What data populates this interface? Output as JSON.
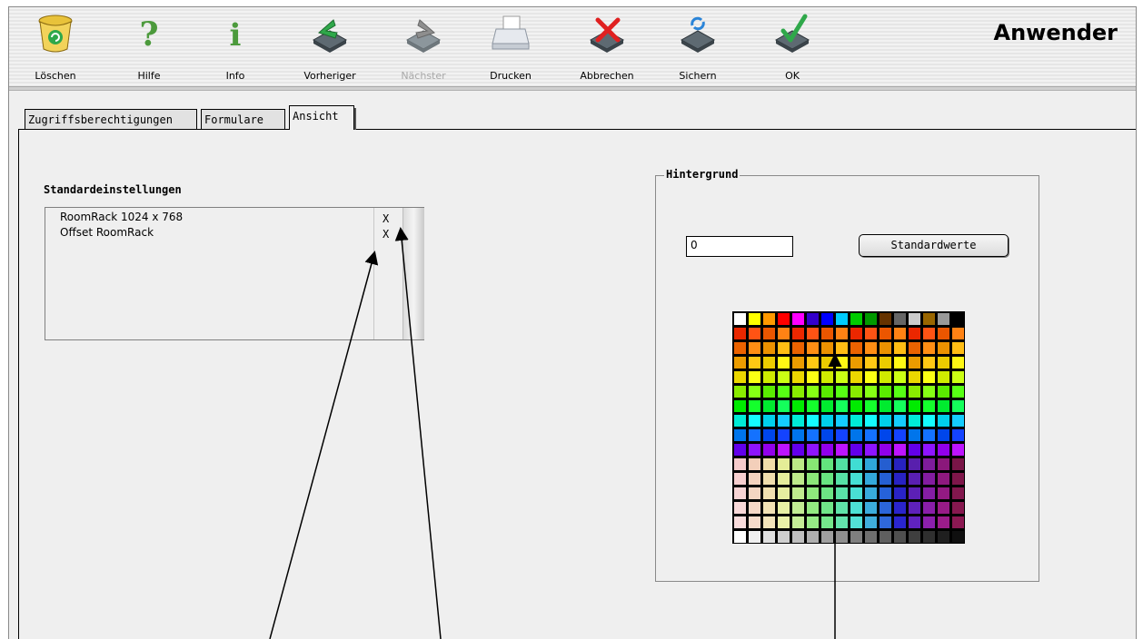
{
  "toolbar": {
    "buttons": [
      {
        "label": "Löschen",
        "icon": "trash-icon",
        "disabled": false
      },
      {
        "label": "Hilfe",
        "icon": "help-icon",
        "disabled": false
      },
      {
        "label": "Info",
        "icon": "info-icon",
        "disabled": false
      },
      {
        "label": "Vorheriger",
        "icon": "previous-icon",
        "disabled": false
      },
      {
        "label": "Nächster",
        "icon": "next-icon",
        "disabled": true
      },
      {
        "label": "Drucken",
        "icon": "printer-icon",
        "disabled": false
      },
      {
        "label": "Abbrechen",
        "icon": "cancel-icon",
        "disabled": false
      },
      {
        "label": "Sichern",
        "icon": "save-icon",
        "disabled": false
      },
      {
        "label": "OK",
        "icon": "ok-icon",
        "disabled": false
      }
    ],
    "title": "Anwender"
  },
  "tabs": [
    {
      "label": "Zugriffsberechtigungen",
      "active": false
    },
    {
      "label": "Formulare",
      "active": false
    },
    {
      "label": "Ansicht",
      "active": true
    }
  ],
  "settings": {
    "heading": "Standardeinstellungen",
    "rows": [
      {
        "name": "RoomRack 1024 x 768",
        "mark": "X"
      },
      {
        "name": "Offset RoomRack",
        "mark": "X"
      }
    ]
  },
  "background": {
    "title": "Hintergrund",
    "value": "0",
    "defaults_button": "Standardwerte",
    "palette_colors": [
      [
        "#ffffff",
        "#ffff00",
        "#ff9900",
        "#ff0000",
        "#ff00ff",
        "#3300cc",
        "#0000ff",
        "#00ccff",
        "#00cc00",
        "#009900",
        "#663300",
        "#666666",
        "#cccccc",
        "#996600",
        "#999999",
        "#000000"
      ]
    ]
  }
}
